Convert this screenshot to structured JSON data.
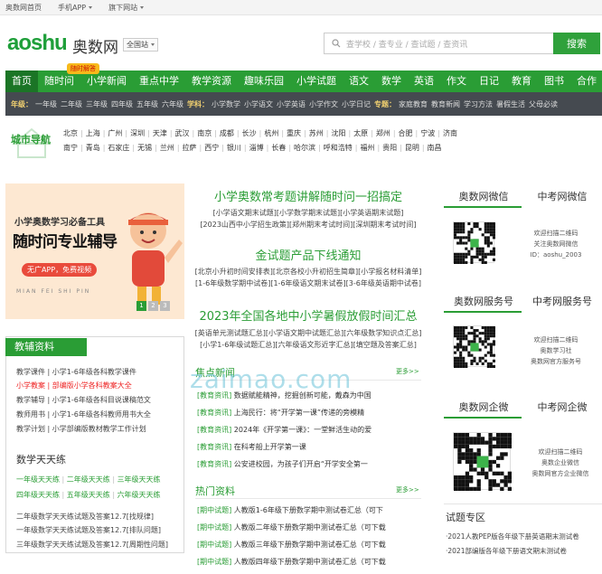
{
  "top": {
    "home": "奥数网首页",
    "app": "手机APP",
    "sites": "旗下网站"
  },
  "logo": {
    "en": "aoshu",
    "cn": "奥数网",
    "station": "全国站"
  },
  "search": {
    "placeholder": "查学校 / 查专业 / 查试题 / 查资讯",
    "button": "搜索"
  },
  "nav": [
    "首页",
    "随时问",
    "小学新闻",
    "重点中学",
    "教学资源",
    "趣味乐园",
    "小学试题",
    "语文",
    "数学",
    "英语",
    "作文",
    "日记",
    "教育",
    "图书",
    "合作"
  ],
  "nav_badge": "随时解答",
  "subnav": {
    "g_label": "年级：",
    "grades": [
      "一年级",
      "二年级",
      "三年级",
      "四年级",
      "五年级",
      "六年级"
    ],
    "s_label": "学科：",
    "subjects": [
      "小学数学",
      "小学语文",
      "小学英语",
      "小学作文",
      "小学日记"
    ],
    "t_label": "专题：",
    "topics": [
      "家庭教育",
      "教育新闻",
      "学习方法",
      "暑假生活",
      "父母必读"
    ]
  },
  "city": {
    "title": "城市导航",
    "row1": [
      "北京",
      "上海",
      "广州",
      "深圳",
      "天津",
      "武汉",
      "南京",
      "成都",
      "长沙",
      "杭州",
      "重庆",
      "苏州",
      "沈阳",
      "太原",
      "郑州",
      "合肥",
      "宁波",
      "济南"
    ],
    "row2": [
      "南宁",
      "青岛",
      "石家庄",
      "无锡",
      "兰州",
      "拉萨",
      "西宁",
      "银川",
      "淄博",
      "长春",
      "哈尔滨",
      "呼和浩特",
      "福州",
      "贵阳",
      "昆明",
      "南昌"
    ]
  },
  "banner": {
    "l1": "小学奥数学习必备工具",
    "l2": "随时问专业辅导",
    "l3": "无广APP，免费视频",
    "l4": "MIAN FEI SHI PIN",
    "pages": [
      "1",
      "2",
      "3"
    ]
  },
  "news": [
    {
      "title": "小学奥数常考题讲解随时问一招搞定",
      "links": [
        "[小学语文期末试题]",
        "[小学数学期末试题]",
        "[小学英语期末试题]",
        "[2023山西中小学招生政策]",
        "[郑州期末考试时间]",
        "[深圳期末考试时间]"
      ]
    },
    {
      "title": "金试题产品下线通知",
      "links": [
        "[北京小升初时间安排表]",
        "[北京各校小升初招生简章]",
        "[小学报名材料清单]",
        "[1-6年级数学期中试卷]",
        "[1-6年级语文期末试卷]",
        "[3-6年级英语期中试卷]"
      ]
    },
    {
      "title": "2023年全国各地中小学暑假放假时间汇总",
      "links": [
        "[英语单元测试题汇总]",
        "[小学语文期中试题汇总]",
        "[六年级数学知识点汇总]",
        "[小学1-6年级试题汇总]",
        "[六年级语文形近字汇总]",
        "[填空题及答案汇总]"
      ]
    }
  ],
  "left": {
    "title": "教辅资料",
    "lines": [
      "教学课件 | 小学1-6年级各科教学课件",
      "小学教案 | 部编版小学各科教案大全",
      "教学辅导 | 小学1-6年级各科目说课稿范文",
      "教师用书 | 小学1-6年级各科教师用书大全",
      "教学计划 | 小学部编版教材教学工作计划"
    ],
    "t2": "数学天天练",
    "links": [
      "一年级天天练",
      "二年级天天练",
      "三年级天天练",
      "四年级天天练",
      "五年级天天练",
      "六年级天天练"
    ],
    "lines2": [
      "二年级数学天天练试题及答案12.7[找规律]",
      "一年级数学天天练试题及答案12.7[排队问题]",
      "三年级数学天天练试题及答案12.7[周期性问题]"
    ]
  },
  "focus": {
    "title": "焦点新闻",
    "more": "更多>>",
    "items": [
      {
        "tag": "[教育资讯]",
        "text": "数据赋能精神，挖掘创新可能，戴森为中国"
      },
      {
        "tag": "[教育资讯]",
        "text": "上海民行：将“开学第一课”传递的旁模精"
      },
      {
        "tag": "[教育资讯]",
        "text": "2024年《开学第一课》：一堂鲜活生动的爱"
      },
      {
        "tag": "[教育资讯]",
        "text": "在科考船上开学第一课"
      },
      {
        "tag": "[教育资讯]",
        "text": "公安进校园，为孩子们开启“开学安全第一"
      }
    ]
  },
  "hot": {
    "title": "热门资料",
    "more": "更多>>",
    "items": [
      {
        "tag": "[期中试题]",
        "text": "人教版1-6年级下册数学期中测试卷汇总（可下"
      },
      {
        "tag": "[期中试题]",
        "text": "人教版二年级下册数学期中测试卷汇总（可下载"
      },
      {
        "tag": "[期中试题]",
        "text": "人教版三年级下册数学期中测试卷汇总（可下载"
      },
      {
        "tag": "[期中试题]",
        "text": "人教版四年级下册数学期中测试卷汇总（可下载"
      }
    ]
  },
  "right": {
    "tabs1": [
      "奥数网微信",
      "中考网微信"
    ],
    "t1": [
      "欢迎扫描二维码",
      "关注奥数网微信",
      "ID：aoshu_2003"
    ],
    "tabs2": [
      "奥数网服务号",
      "中考网服务号"
    ],
    "t2": [
      "欢迎扫描二维码",
      "奥数学习社",
      "奥数网官方服务号"
    ],
    "tabs3": [
      "奥数网企微",
      "中考网企微"
    ],
    "t3": [
      "欢迎扫描二维码",
      "奥数企业微信",
      "奥数网官方企业微信"
    ],
    "exam_title": "试题专区",
    "exam": [
      "·2021人教PEP版各年级下册英语期末测试卷",
      "·2021部编版各年级下册语文期末测试卷"
    ]
  },
  "watermark": "zaimao.com"
}
